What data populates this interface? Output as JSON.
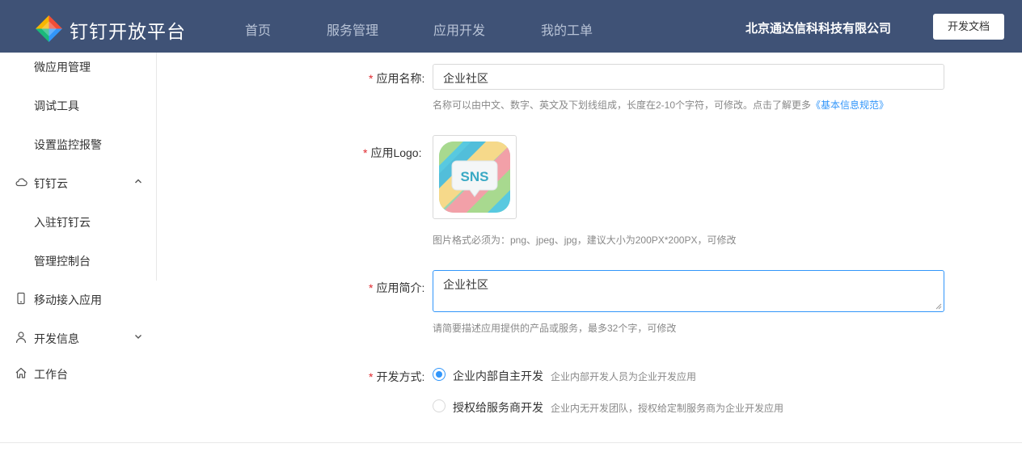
{
  "header": {
    "brand": "钉钉开放平台",
    "nav": [
      "首页",
      "服务管理",
      "应用开发",
      "我的工单"
    ],
    "company": "北京通达信科科技有限公司",
    "doc_button": "开发文档"
  },
  "sidebar": {
    "items": [
      {
        "label": "微应用管理",
        "icon": "",
        "arrow": ""
      },
      {
        "label": "调试工具",
        "icon": "",
        "arrow": ""
      },
      {
        "label": "设置监控报警",
        "icon": "",
        "arrow": ""
      },
      {
        "label": "钉钉云",
        "icon": "cloud-icon",
        "arrow": "chevron-up-icon"
      },
      {
        "label": "入驻钉钉云",
        "icon": "",
        "arrow": ""
      },
      {
        "label": "管理控制台",
        "icon": "",
        "arrow": ""
      },
      {
        "label": "移动接入应用",
        "icon": "mobile-icon",
        "arrow": ""
      },
      {
        "label": "开发信息",
        "icon": "user-icon",
        "arrow": "chevron-down-icon"
      },
      {
        "label": "工作台",
        "icon": "home-icon",
        "arrow": ""
      }
    ]
  },
  "form": {
    "required_mark": "*",
    "name": {
      "label": "应用名称:",
      "value": "企业社区",
      "hint": "名称可以由中文、数字、英文及下划线组成，长度在2-10个字符，可修改。点击了解更多",
      "hint_link": "《基本信息规范》"
    },
    "logo": {
      "label": "应用Logo:",
      "logo_text": "SNS",
      "hint": "图片格式必须为：png、jpeg、jpg，建议大小为200PX*200PX，可修改"
    },
    "intro": {
      "label": "应用简介:",
      "value": "企业社区",
      "hint": "请简要描述应用提供的产品或服务，最多32个字，可修改"
    },
    "dev_mode": {
      "label": "开发方式:",
      "options": [
        {
          "label": "企业内部自主开发",
          "desc": "企业内部开发人员为企业开发应用",
          "checked": true
        },
        {
          "label": "授权给服务商开发",
          "desc": "企业内无开发团队，授权给定制服务商为企业开发应用",
          "checked": false
        }
      ]
    }
  },
  "colors": {
    "header_bg": "#3f5276",
    "accent": "#3296fa",
    "required": "#e0282e"
  }
}
